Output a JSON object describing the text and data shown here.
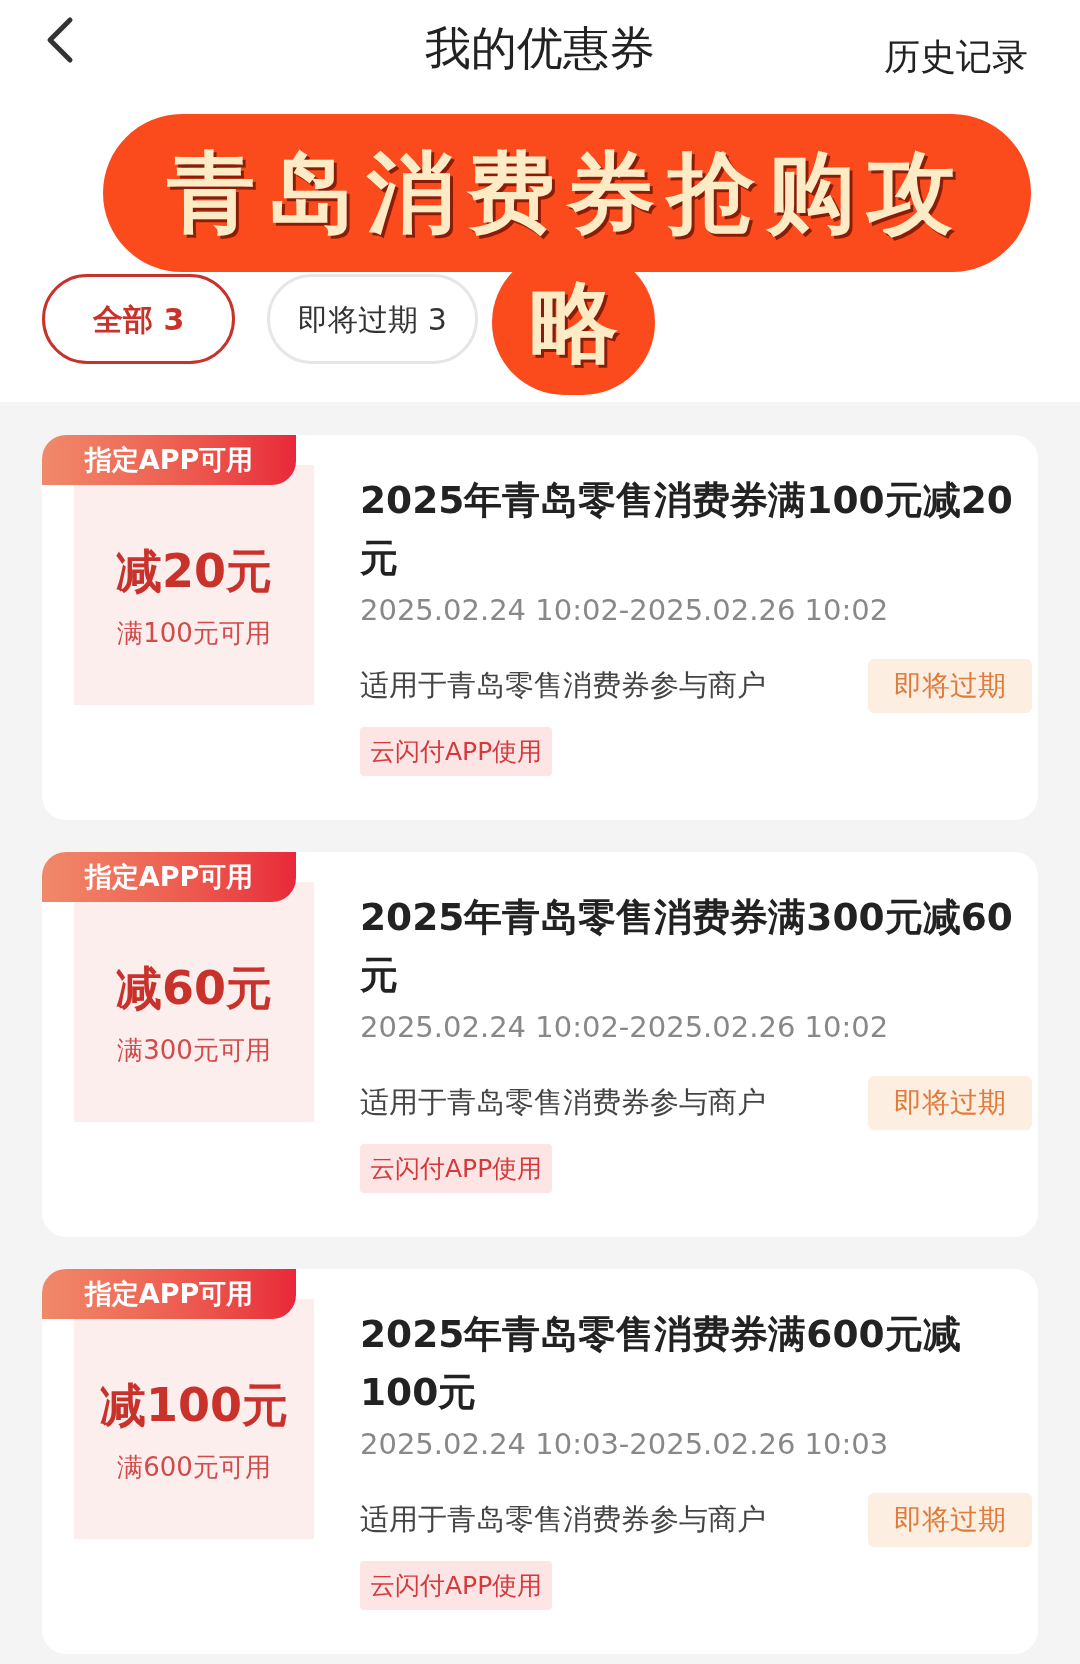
{
  "header": {
    "title": "我的优惠券",
    "history_link": "历史记录"
  },
  "overlay_title_lines": [
    "青岛消费券抢购攻",
    "略"
  ],
  "filter_tabs": [
    {
      "label": "全部 3",
      "selected": true
    },
    {
      "label": "即将过期 3",
      "selected": false
    }
  ],
  "coupons": [
    {
      "tag": "指定APP可用",
      "amount": "减20元",
      "condition": "满100元可用",
      "title": "2025年青岛零售消费券满100元减20元",
      "validity": "2025.02.24 10:02-2025.02.26 10:02",
      "scope": "适用于青岛零售消费券参与商户",
      "status": "即将过期",
      "channel": "云闪付APP使用"
    },
    {
      "tag": "指定APP可用",
      "amount": "减60元",
      "condition": "满300元可用",
      "title": "2025年青岛零售消费券满300元减60元",
      "validity": "2025.02.24 10:02-2025.02.26 10:02",
      "scope": "适用于青岛零售消费券参与商户",
      "status": "即将过期",
      "channel": "云闪付APP使用"
    },
    {
      "tag": "指定APP可用",
      "amount": "减100元",
      "condition": "满600元可用",
      "title": "2025年青岛零售消费券满600元减100元",
      "validity": "2025.02.24 10:03-2025.02.26 10:03",
      "scope": "适用于青岛零售消费券参与商户",
      "status": "即将过期",
      "channel": "云闪付APP使用"
    }
  ]
}
